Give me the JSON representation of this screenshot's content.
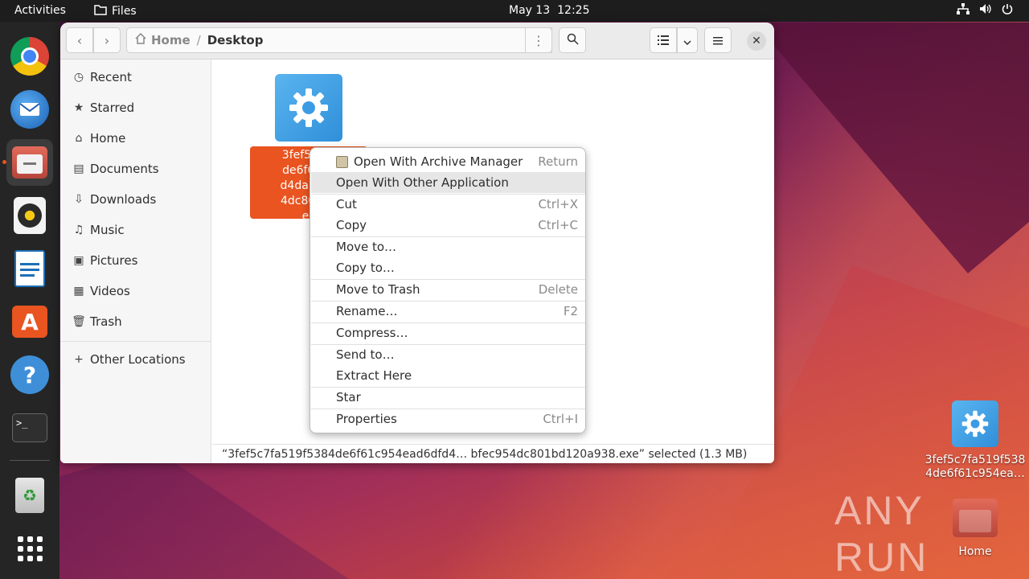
{
  "topbar": {
    "activities": "Activities",
    "app_name": "Files",
    "date": "May 13",
    "time": "12:25"
  },
  "window": {
    "path": {
      "home": "Home",
      "current": "Desktop"
    },
    "sidebar": [
      {
        "label": "Recent",
        "icon": "clock-icon"
      },
      {
        "label": "Starred",
        "icon": "star-icon"
      },
      {
        "label": "Home",
        "icon": "home-icon"
      },
      {
        "label": "Documents",
        "icon": "document-icon"
      },
      {
        "label": "Downloads",
        "icon": "download-icon"
      },
      {
        "label": "Music",
        "icon": "music-icon"
      },
      {
        "label": "Pictures",
        "icon": "picture-icon"
      },
      {
        "label": "Videos",
        "icon": "video-icon"
      },
      {
        "label": "Trash",
        "icon": "trash-icon"
      },
      {
        "label": "Other Locations",
        "icon": "plus-icon"
      }
    ],
    "file": {
      "label_lines": [
        "3fef5c7fa",
        "de6f61c9",
        "d4da7270",
        "4dc801bd",
        "ex"
      ]
    },
    "status": "“3fef5c7fa519f5384de6f61c954ead6dfd4… bfec954dc801bd120a938.exe” selected (1.3 MB)"
  },
  "menu": [
    {
      "label": "Open With Archive Manager",
      "accel": "Return"
    },
    {
      "label": "Open With Other Application",
      "accel": ""
    },
    {
      "label": "Cut",
      "accel": "Ctrl+X"
    },
    {
      "label": "Copy",
      "accel": "Ctrl+C"
    },
    {
      "label": "Move to…",
      "accel": ""
    },
    {
      "label": "Copy to…",
      "accel": ""
    },
    {
      "label": "Move to Trash",
      "accel": "Delete"
    },
    {
      "label": "Rename…",
      "accel": "F2"
    },
    {
      "label": "Compress…",
      "accel": ""
    },
    {
      "label": "Send to…",
      "accel": ""
    },
    {
      "label": "Extract Here",
      "accel": ""
    },
    {
      "label": "Star",
      "accel": ""
    },
    {
      "label": "Properties",
      "accel": "Ctrl+I"
    }
  ],
  "desktop": {
    "file_line1": "3fef5c7fa519f538",
    "file_line2": "4de6f61c954ea…",
    "home_label": "Home"
  },
  "watermark": "ANY RUN"
}
